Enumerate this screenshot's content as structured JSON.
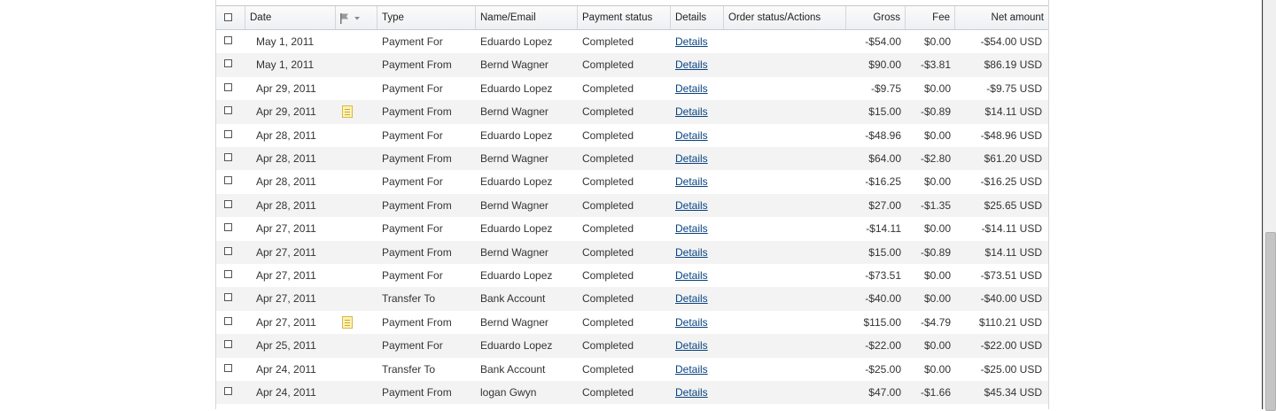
{
  "table": {
    "columns": {
      "date": "Date",
      "type": "Type",
      "name": "Name/Email",
      "status": "Payment status",
      "details": "Details",
      "order": "Order status/Actions",
      "gross": "Gross",
      "fee": "Fee",
      "net": "Net amount"
    },
    "flag_icon": "flag-dropdown-icon",
    "note_icon": "note-icon",
    "rows": [
      {
        "date": "May 1, 2011",
        "note": false,
        "type": "Payment For",
        "name": "Eduardo Lopez",
        "status": "Completed",
        "details": "Details",
        "gross": "-$54.00",
        "fee": "$0.00",
        "net": "-$54.00 USD"
      },
      {
        "date": "May 1, 2011",
        "note": false,
        "type": "Payment From",
        "name": "Bernd Wagner",
        "status": "Completed",
        "details": "Details",
        "gross": "$90.00",
        "fee": "-$3.81",
        "net": "$86.19 USD"
      },
      {
        "date": "Apr 29, 2011",
        "note": false,
        "type": "Payment For",
        "name": "Eduardo Lopez",
        "status": "Completed",
        "details": "Details",
        "gross": "-$9.75",
        "fee": "$0.00",
        "net": "-$9.75 USD"
      },
      {
        "date": "Apr 29, 2011",
        "note": true,
        "type": "Payment From",
        "name": "Bernd Wagner",
        "status": "Completed",
        "details": "Details",
        "gross": "$15.00",
        "fee": "-$0.89",
        "net": "$14.11 USD"
      },
      {
        "date": "Apr 28, 2011",
        "note": false,
        "type": "Payment For",
        "name": "Eduardo Lopez",
        "status": "Completed",
        "details": "Details",
        "gross": "-$48.96",
        "fee": "$0.00",
        "net": "-$48.96 USD"
      },
      {
        "date": "Apr 28, 2011",
        "note": false,
        "type": "Payment From",
        "name": "Bernd Wagner",
        "status": "Completed",
        "details": "Details",
        "gross": "$64.00",
        "fee": "-$2.80",
        "net": "$61.20 USD"
      },
      {
        "date": "Apr 28, 2011",
        "note": false,
        "type": "Payment For",
        "name": "Eduardo Lopez",
        "status": "Completed",
        "details": "Details",
        "gross": "-$16.25",
        "fee": "$0.00",
        "net": "-$16.25 USD"
      },
      {
        "date": "Apr 28, 2011",
        "note": false,
        "type": "Payment From",
        "name": "Bernd Wagner",
        "status": "Completed",
        "details": "Details",
        "gross": "$27.00",
        "fee": "-$1.35",
        "net": "$25.65 USD"
      },
      {
        "date": "Apr 27, 2011",
        "note": false,
        "type": "Payment For",
        "name": "Eduardo Lopez",
        "status": "Completed",
        "details": "Details",
        "gross": "-$14.11",
        "fee": "$0.00",
        "net": "-$14.11 USD"
      },
      {
        "date": "Apr 27, 2011",
        "note": false,
        "type": "Payment From",
        "name": "Bernd Wagner",
        "status": "Completed",
        "details": "Details",
        "gross": "$15.00",
        "fee": "-$0.89",
        "net": "$14.11 USD"
      },
      {
        "date": "Apr 27, 2011",
        "note": false,
        "type": "Payment For",
        "name": "Eduardo Lopez",
        "status": "Completed",
        "details": "Details",
        "gross": "-$73.51",
        "fee": "$0.00",
        "net": "-$73.51 USD"
      },
      {
        "date": "Apr 27, 2011",
        "note": false,
        "type": "Transfer To",
        "name": "Bank Account",
        "status": "Completed",
        "details": "Details",
        "gross": "-$40.00",
        "fee": "$0.00",
        "net": "-$40.00 USD"
      },
      {
        "date": "Apr 27, 2011",
        "note": true,
        "type": "Payment From",
        "name": "Bernd Wagner",
        "status": "Completed",
        "details": "Details",
        "gross": "$115.00",
        "fee": "-$4.79",
        "net": "$110.21 USD"
      },
      {
        "date": "Apr 25, 2011",
        "note": false,
        "type": "Payment For",
        "name": "Eduardo Lopez",
        "status": "Completed",
        "details": "Details",
        "gross": "-$22.00",
        "fee": "$0.00",
        "net": "-$22.00 USD"
      },
      {
        "date": "Apr 24, 2011",
        "note": false,
        "type": "Transfer To",
        "name": "Bank Account",
        "status": "Completed",
        "details": "Details",
        "gross": "-$25.00",
        "fee": "$0.00",
        "net": "-$25.00 USD"
      },
      {
        "date": "Apr 24, 2011",
        "note": false,
        "type": "Payment From",
        "name": "logan Gwyn",
        "status": "Completed",
        "details": "Details",
        "gross": "$47.00",
        "fee": "-$1.66",
        "net": "$45.34 USD"
      }
    ]
  },
  "colors": {
    "link": "#084482",
    "row_alt": "#f3f3f3",
    "header_bg": "#eef0f3"
  }
}
